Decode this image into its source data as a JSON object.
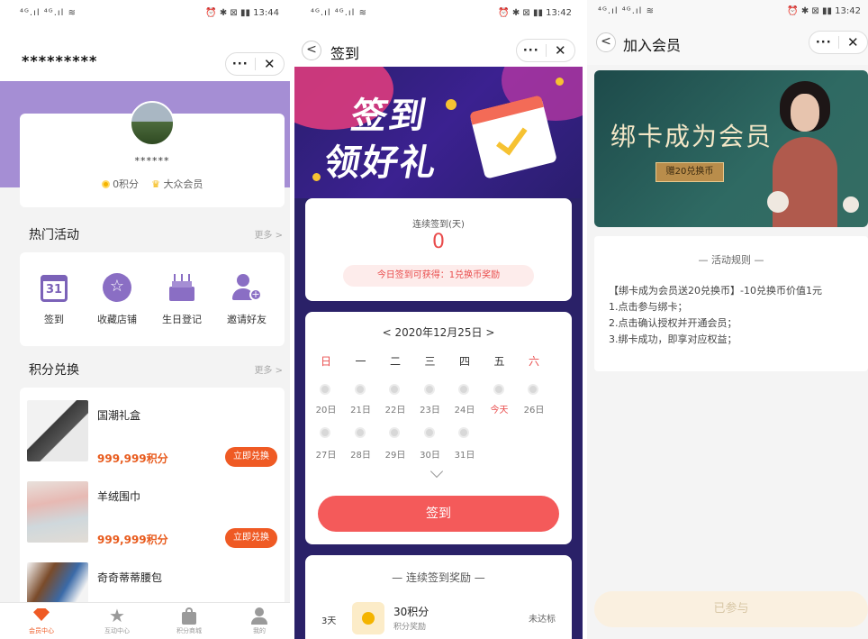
{
  "status": {
    "p1_time": "13:44",
    "p2_time": "13:42",
    "p3_time": "13:42",
    "signal": "⁴ᴳ.ıl ⁴ᴳ.ıl ≋",
    "icons": "⏰ ✱ ⊠ ▮▮"
  },
  "capsule": {
    "dots": "···",
    "close": "✕"
  },
  "p1": {
    "title": "*********",
    "username": "******",
    "points_label": "0积分",
    "member_label": "大众会员",
    "hot_title": "热门活动",
    "more": "更多 >",
    "activities": [
      {
        "label": "签到",
        "day": "31"
      },
      {
        "label": "收藏店铺"
      },
      {
        "label": "生日登记"
      },
      {
        "label": "邀请好友"
      }
    ],
    "exchange_title": "积分兑换",
    "products": [
      {
        "name": "国潮礼盒",
        "points": "999,999积分",
        "button": "立即兑换"
      },
      {
        "name": "羊绒围巾",
        "points": "999,999积分",
        "button": "立即兑换"
      },
      {
        "name": "奇奇蒂蒂腰包"
      }
    ],
    "tabs": [
      "会员中心",
      "互动中心",
      "积分商城",
      "我的"
    ]
  },
  "p2": {
    "back": "<",
    "title": "签到",
    "banner_line1": "签到",
    "banner_line2": "领好礼",
    "streak_label": "连续签到(天)",
    "streak_value": "0",
    "today_reward": "今日签到可获得：1兑换币奖励",
    "month": "<  2020年12月25日  >",
    "weekdays": [
      "日",
      "一",
      "二",
      "三",
      "四",
      "五",
      "六"
    ],
    "weekend_color": "#e94b4b",
    "week1": [
      "20日",
      "21日",
      "22日",
      "23日",
      "24日",
      "今天",
      "26日"
    ],
    "week2": [
      "27日",
      "28日",
      "29日",
      "30日",
      "31日"
    ],
    "sign_button": "签到",
    "reward_title": "— 连续签到奖励 —",
    "reward_day": "3天",
    "reward_name": "30积分",
    "reward_sub": "积分奖励",
    "reward_status": "未达标"
  },
  "p3": {
    "back": "<",
    "title": "加入会员",
    "banner_title": "绑卡成为会员",
    "banner_tag": "赠20兑换币",
    "rules_title": "— 活动规则 —",
    "rules": [
      "【绑卡成为会员送20兑换币】-10兑换币价值1元",
      "1.点击参与绑卡；",
      "2.点击确认授权并开通会员；",
      "3.绑卡成功，即享对应权益；"
    ],
    "joined_button": "已参与"
  },
  "colors": {
    "accent_orange": "#ef5a24",
    "accent_red": "#f45a5a",
    "header_purple": "#a58ed4",
    "banner_navy": "#2a2168"
  }
}
